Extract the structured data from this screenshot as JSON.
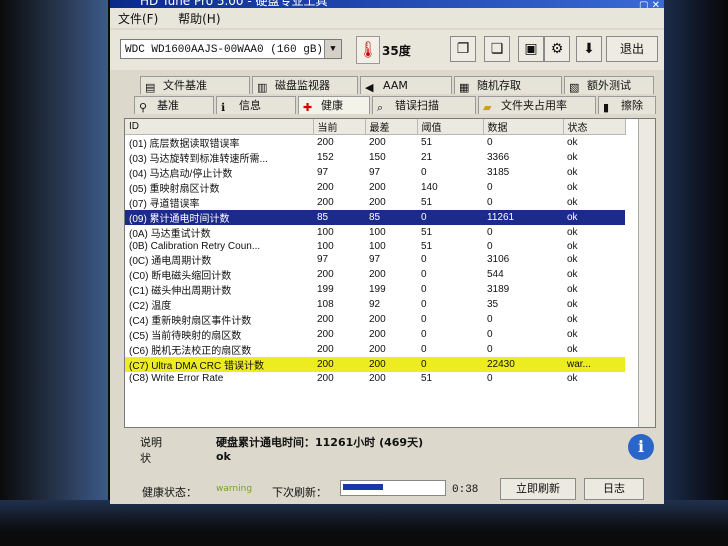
{
  "window": {
    "title": "HD Tune Pro 5.00 - 硬盘专业工具"
  },
  "menu": {
    "file": "文件(F)",
    "help": "帮助(H)"
  },
  "toolbar": {
    "drive": "WDC WD1600AAJS-00WAA0 (160 gB)",
    "temperature": "35度",
    "exit_label": "退出",
    "icons": [
      "copy-icon",
      "paste-icon",
      "save-icon",
      "options-icon",
      "download-icon"
    ]
  },
  "tabs_top": [
    "文件基准",
    "磁盘监视器",
    "AAM",
    "随机存取",
    "额外测试"
  ],
  "tabs_bottom": [
    "基准",
    "信息",
    "健康",
    "错误扫描",
    "文件夹占用率",
    "擦除"
  ],
  "active_tab": "健康",
  "table": {
    "columns": [
      "ID",
      "当前",
      "最差",
      "阈值",
      "数据",
      "状态"
    ],
    "rows": [
      {
        "id": "(01) 底层数据读取错误率",
        "cur": "200",
        "worst": "200",
        "thr": "51",
        "data": "0",
        "status": "ok"
      },
      {
        "id": "(03) 马达旋转到标准转速所需...",
        "cur": "152",
        "worst": "150",
        "thr": "21",
        "data": "3366",
        "status": "ok"
      },
      {
        "id": "(04) 马达启动/停止计数",
        "cur": "97",
        "worst": "97",
        "thr": "0",
        "data": "3185",
        "status": "ok"
      },
      {
        "id": "(05) 重映射扇区计数",
        "cur": "200",
        "worst": "200",
        "thr": "140",
        "data": "0",
        "status": "ok"
      },
      {
        "id": "(07) 寻道错误率",
        "cur": "200",
        "worst": "200",
        "thr": "51",
        "data": "0",
        "status": "ok"
      },
      {
        "id": "(09) 累计通电时间计数",
        "cur": "85",
        "worst": "85",
        "thr": "0",
        "data": "11261",
        "status": "ok"
      },
      {
        "id": "(0A) 马达重试计数",
        "cur": "100",
        "worst": "100",
        "thr": "51",
        "data": "0",
        "status": "ok"
      },
      {
        "id": "(0B) Calibration Retry Coun...",
        "cur": "100",
        "worst": "100",
        "thr": "51",
        "data": "0",
        "status": "ok"
      },
      {
        "id": "(0C) 通电周期计数",
        "cur": "97",
        "worst": "97",
        "thr": "0",
        "data": "3106",
        "status": "ok"
      },
      {
        "id": "(C0) 断电磁头缩回计数",
        "cur": "200",
        "worst": "200",
        "thr": "0",
        "data": "544",
        "status": "ok"
      },
      {
        "id": "(C1) 磁头伸出周期计数",
        "cur": "199",
        "worst": "199",
        "thr": "0",
        "data": "3189",
        "status": "ok"
      },
      {
        "id": "(C2) 温度",
        "cur": "108",
        "worst": "92",
        "thr": "0",
        "data": "35",
        "status": "ok"
      },
      {
        "id": "(C4) 重新映射扇区事件计数",
        "cur": "200",
        "worst": "200",
        "thr": "0",
        "data": "0",
        "status": "ok"
      },
      {
        "id": "(C5) 当前待映射的扇区数",
        "cur": "200",
        "worst": "200",
        "thr": "0",
        "data": "0",
        "status": "ok"
      },
      {
        "id": "(C6) 脱机无法校正的扇区数",
        "cur": "200",
        "worst": "200",
        "thr": "0",
        "data": "0",
        "status": "ok"
      },
      {
        "id": "(C7) Ultra DMA CRC 错误计数",
        "cur": "200",
        "worst": "200",
        "thr": "0",
        "data": "22430",
        "status": "war..."
      },
      {
        "id": "(C8) Write Error Rate",
        "cur": "200",
        "worst": "200",
        "thr": "51",
        "data": "0",
        "status": "ok"
      }
    ],
    "selected_index": 5,
    "warning_index": 15
  },
  "details": {
    "desc_label": "说明",
    "desc_value": "硬盘累计通电时间：11261小时 (469天)",
    "status_label": "状",
    "status_value": "ok"
  },
  "status_bar": {
    "health_label": "健康状态：",
    "health_value": "warning",
    "next_refresh_label": "下次刷新：",
    "progress": 0.4,
    "countdown": "0:38",
    "refresh_label": "立即刷新",
    "log_label": "日志"
  }
}
